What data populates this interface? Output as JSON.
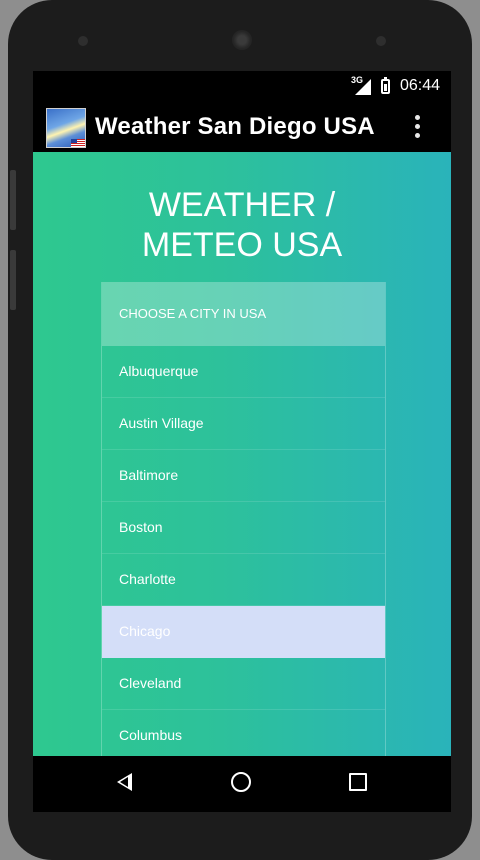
{
  "status_bar": {
    "network": "3G",
    "time": "06:44"
  },
  "action_bar": {
    "title": "Weather San Diego USA",
    "app_icon": "weather-app-icon",
    "overflow_icon": "more-vert-icon"
  },
  "main": {
    "heading_line1": "WEATHER /",
    "heading_line2": "METEO USA",
    "list_header": "CHOOSE A CITY IN USA",
    "cities": [
      {
        "name": "Albuquerque",
        "selected": false
      },
      {
        "name": "Austin Village",
        "selected": false
      },
      {
        "name": "Baltimore",
        "selected": false
      },
      {
        "name": "Boston",
        "selected": false
      },
      {
        "name": "Charlotte",
        "selected": false
      },
      {
        "name": "Chicago",
        "selected": true
      },
      {
        "name": "Cleveland",
        "selected": false
      },
      {
        "name": "Columbus",
        "selected": false
      }
    ]
  },
  "nav_bar": {
    "back": "back-icon",
    "home": "home-icon",
    "recents": "recents-icon"
  },
  "colors": {
    "gradient_start": "#2ec88f",
    "gradient_end": "#2ab3ba",
    "selected_row": "#d4def8"
  }
}
